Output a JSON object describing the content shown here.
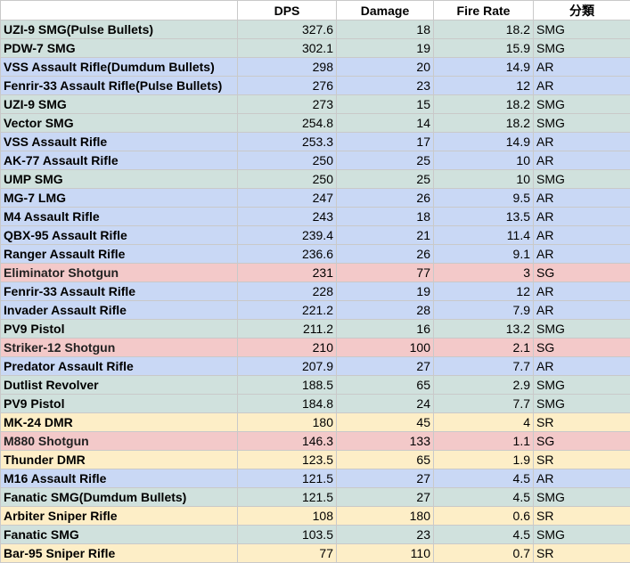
{
  "headers": [
    "",
    "DPS",
    "Damage",
    "Fire Rate",
    "分類"
  ],
  "category_colors": {
    "SMG": "#d0e1dd",
    "AR": "#c9d8f5",
    "SG": "#f3c9c9",
    "SR": "#fdeec7"
  },
  "rows": [
    {
      "name": "UZI-9 SMG(Pulse Bullets)",
      "dps": "327.6",
      "damage": "18",
      "fire_rate": "18.2",
      "category": "SMG"
    },
    {
      "name": "PDW-7 SMG",
      "dps": "302.1",
      "damage": "19",
      "fire_rate": "15.9",
      "category": "SMG"
    },
    {
      "name": "VSS Assault Rifle(Dumdum Bullets)",
      "dps": "298",
      "damage": "20",
      "fire_rate": "14.9",
      "category": "AR"
    },
    {
      "name": "Fenrir-33 Assault Rifle(Pulse Bullets)",
      "dps": "276",
      "damage": "23",
      "fire_rate": "12",
      "category": "AR"
    },
    {
      "name": "UZI-9 SMG",
      "dps": "273",
      "damage": "15",
      "fire_rate": "18.2",
      "category": "SMG"
    },
    {
      "name": "Vector SMG",
      "dps": "254.8",
      "damage": "14",
      "fire_rate": "18.2",
      "category": "SMG"
    },
    {
      "name": "VSS Assault Rifle",
      "dps": "253.3",
      "damage": "17",
      "fire_rate": "14.9",
      "category": "AR"
    },
    {
      "name": "AK-77 Assault Rifle",
      "dps": "250",
      "damage": "25",
      "fire_rate": "10",
      "category": "AR"
    },
    {
      "name": "UMP SMG",
      "dps": "250",
      "damage": "25",
      "fire_rate": "10",
      "category": "SMG"
    },
    {
      "name": "MG-7 LMG",
      "dps": "247",
      "damage": "26",
      "fire_rate": "9.5",
      "category": "AR"
    },
    {
      "name": "M4 Assault Rifle",
      "dps": "243",
      "damage": "18",
      "fire_rate": "13.5",
      "category": "AR"
    },
    {
      "name": "QBX-95 Assault Rifle",
      "dps": "239.4",
      "damage": "21",
      "fire_rate": "11.4",
      "category": "AR"
    },
    {
      "name": "Ranger Assault Rifle",
      "dps": "236.6",
      "damage": "26",
      "fire_rate": "9.1",
      "category": "AR"
    },
    {
      "name": "Eliminator Shotgun",
      "dps": "231",
      "damage": "77",
      "fire_rate": "3",
      "category": "SG"
    },
    {
      "name": "Fenrir-33 Assault Rifle",
      "dps": "228",
      "damage": "19",
      "fire_rate": "12",
      "category": "AR"
    },
    {
      "name": "Invader Assault Rifle",
      "dps": "221.2",
      "damage": "28",
      "fire_rate": "7.9",
      "category": "AR"
    },
    {
      "name": "PV9 Pistol",
      "dps": "211.2",
      "damage": "16",
      "fire_rate": "13.2",
      "category": "SMG"
    },
    {
      "name": "Striker-12 Shotgun",
      "dps": "210",
      "damage": "100",
      "fire_rate": "2.1",
      "category": "SG"
    },
    {
      "name": "Predator Assault Rifle",
      "dps": "207.9",
      "damage": "27",
      "fire_rate": "7.7",
      "category": "AR"
    },
    {
      "name": "Dutlist Revolver",
      "dps": "188.5",
      "damage": "65",
      "fire_rate": "2.9",
      "category": "SMG"
    },
    {
      "name": "PV9 Pistol",
      "dps": "184.8",
      "damage": "24",
      "fire_rate": "7.7",
      "category": "SMG"
    },
    {
      "name": "MK-24 DMR",
      "dps": "180",
      "damage": "45",
      "fire_rate": "4",
      "category": "SR"
    },
    {
      "name": "M880 Shotgun",
      "dps": "146.3",
      "damage": "133",
      "fire_rate": "1.1",
      "category": "SG"
    },
    {
      "name": "Thunder DMR",
      "dps": "123.5",
      "damage": "65",
      "fire_rate": "1.9",
      "category": "SR"
    },
    {
      "name": "M16 Assault Rifle",
      "dps": "121.5",
      "damage": "27",
      "fire_rate": "4.5",
      "category": "AR"
    },
    {
      "name": "Fanatic SMG(Dumdum Bullets)",
      "dps": "121.5",
      "damage": "27",
      "fire_rate": "4.5",
      "category": "SMG"
    },
    {
      "name": "Arbiter Sniper Rifle",
      "dps": "108",
      "damage": "180",
      "fire_rate": "0.6",
      "category": "SR"
    },
    {
      "name": "Fanatic SMG",
      "dps": "103.5",
      "damage": "23",
      "fire_rate": "4.5",
      "category": "SMG"
    },
    {
      "name": "Bar-95 Sniper Rifle",
      "dps": "77",
      "damage": "110",
      "fire_rate": "0.7",
      "category": "SR"
    }
  ]
}
